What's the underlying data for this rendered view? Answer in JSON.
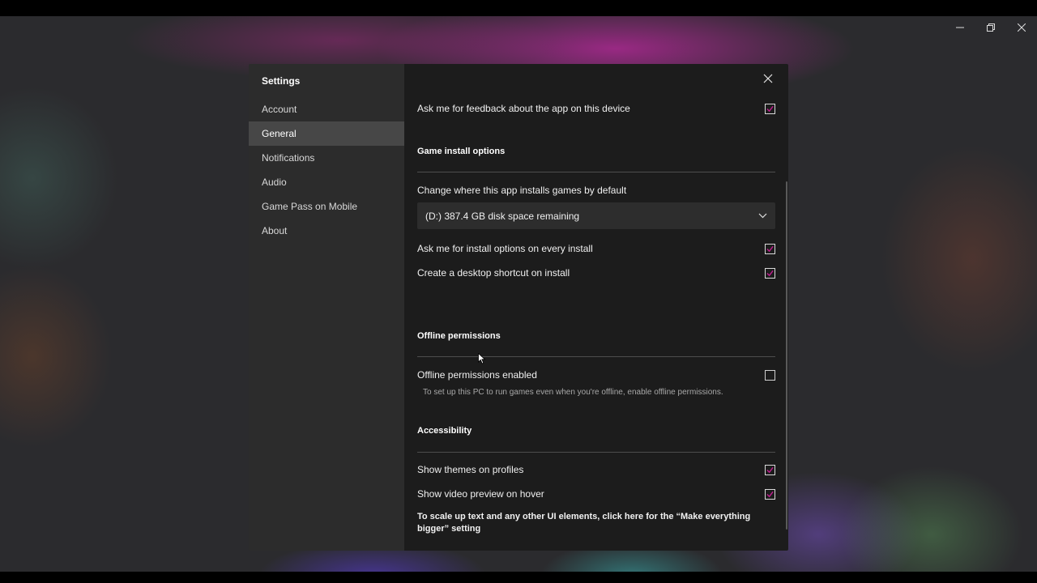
{
  "colors": {
    "accent": "#c01f8f",
    "sidebar_bg": "#2c2c2c",
    "content_bg": "#1c1c1c",
    "active_item_bg": "#474747"
  },
  "window_controls": {
    "minimize": "minimize-icon",
    "restore": "restore-icon",
    "close": "close-icon"
  },
  "sidebar": {
    "title": "Settings",
    "items": [
      {
        "label": "Account",
        "active": false
      },
      {
        "label": "General",
        "active": true
      },
      {
        "label": "Notifications",
        "active": false
      },
      {
        "label": "Audio",
        "active": false
      },
      {
        "label": "Game Pass on Mobile",
        "active": false
      },
      {
        "label": "About",
        "active": false
      }
    ]
  },
  "content": {
    "feedback": {
      "label": "Ask me for feedback about the app on this device",
      "checked": true
    },
    "game_install": {
      "title": "Game install options",
      "location_label": "Change where this app installs games by default",
      "location_value": "(D:) 387.4 GB disk space remaining",
      "ask_install_options": {
        "label": "Ask me for install options on every install",
        "checked": true
      },
      "desktop_shortcut": {
        "label": "Create a desktop shortcut on install",
        "checked": true
      }
    },
    "offline": {
      "title": "Offline permissions",
      "enabled": {
        "label": "Offline permissions enabled",
        "checked": false
      },
      "help": "To set up this PC to run games even when you're offline, enable offline permissions."
    },
    "accessibility": {
      "title": "Accessibility",
      "themes": {
        "label": "Show themes on profiles",
        "checked": true
      },
      "video_preview": {
        "label": "Show video preview on hover",
        "checked": true
      },
      "bigger_link": "To scale up text and any other UI elements, click here for the “Make everything bigger” setting"
    }
  }
}
